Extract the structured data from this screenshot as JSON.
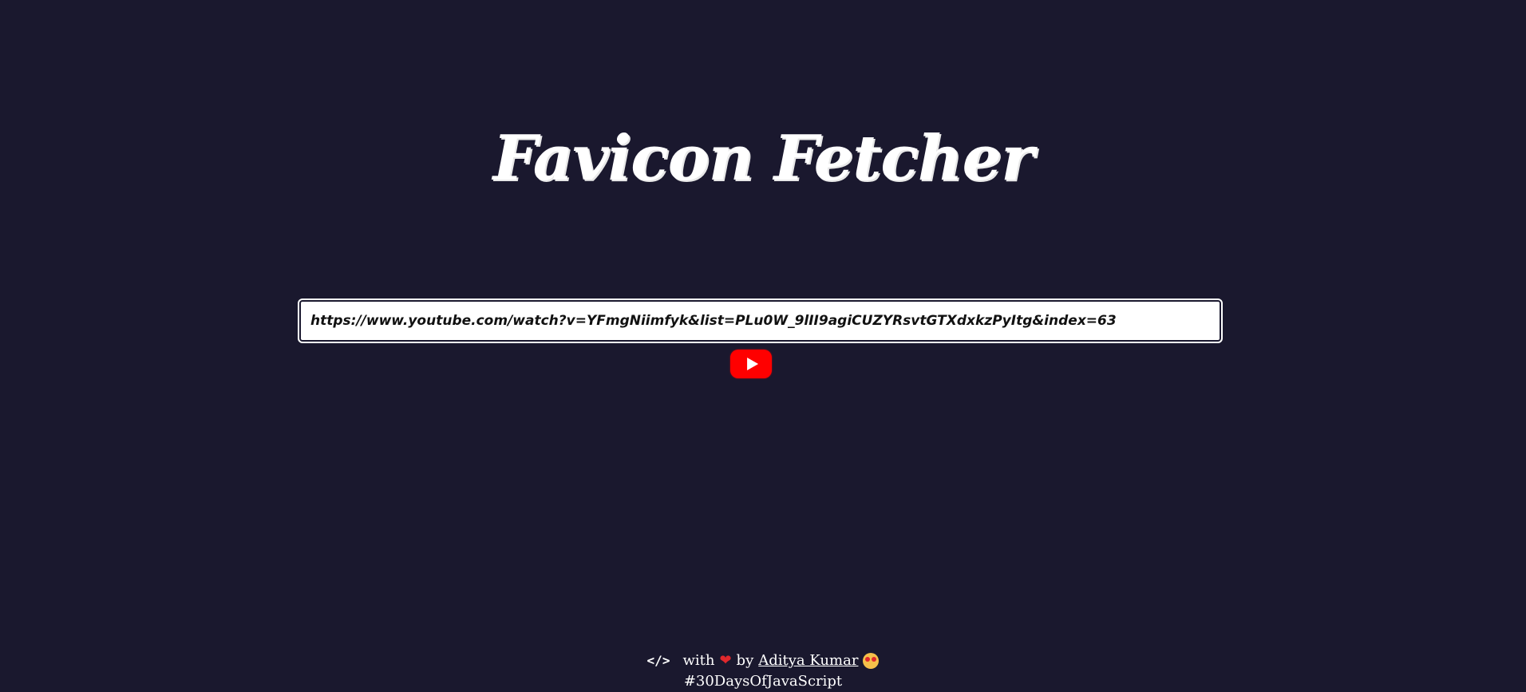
{
  "header": {
    "title": "Favicon Fetcher"
  },
  "search": {
    "value": "https://www.youtube.com/watch?v=YFmgNiimfyk&list=PLu0W_9lII9agiCUZYRsvtGTXdxkzPyItg&index=63"
  },
  "result": {
    "favicon_icon": "youtube-logo-icon",
    "favicon_color": "#ff0000"
  },
  "footer": {
    "code_symbol": "</>",
    "with_text": "with",
    "heart_icon": "heart-icon",
    "heart_symbol": "❤",
    "by_text": "by",
    "author_name": "Aditya Kumar",
    "emoji_icon": "star-struck-emoji-icon",
    "hashtag": "#30DaysOfJavaScript"
  },
  "colors": {
    "background": "#1a182e",
    "text": "#ffffff",
    "accent_red": "#ff0000"
  }
}
